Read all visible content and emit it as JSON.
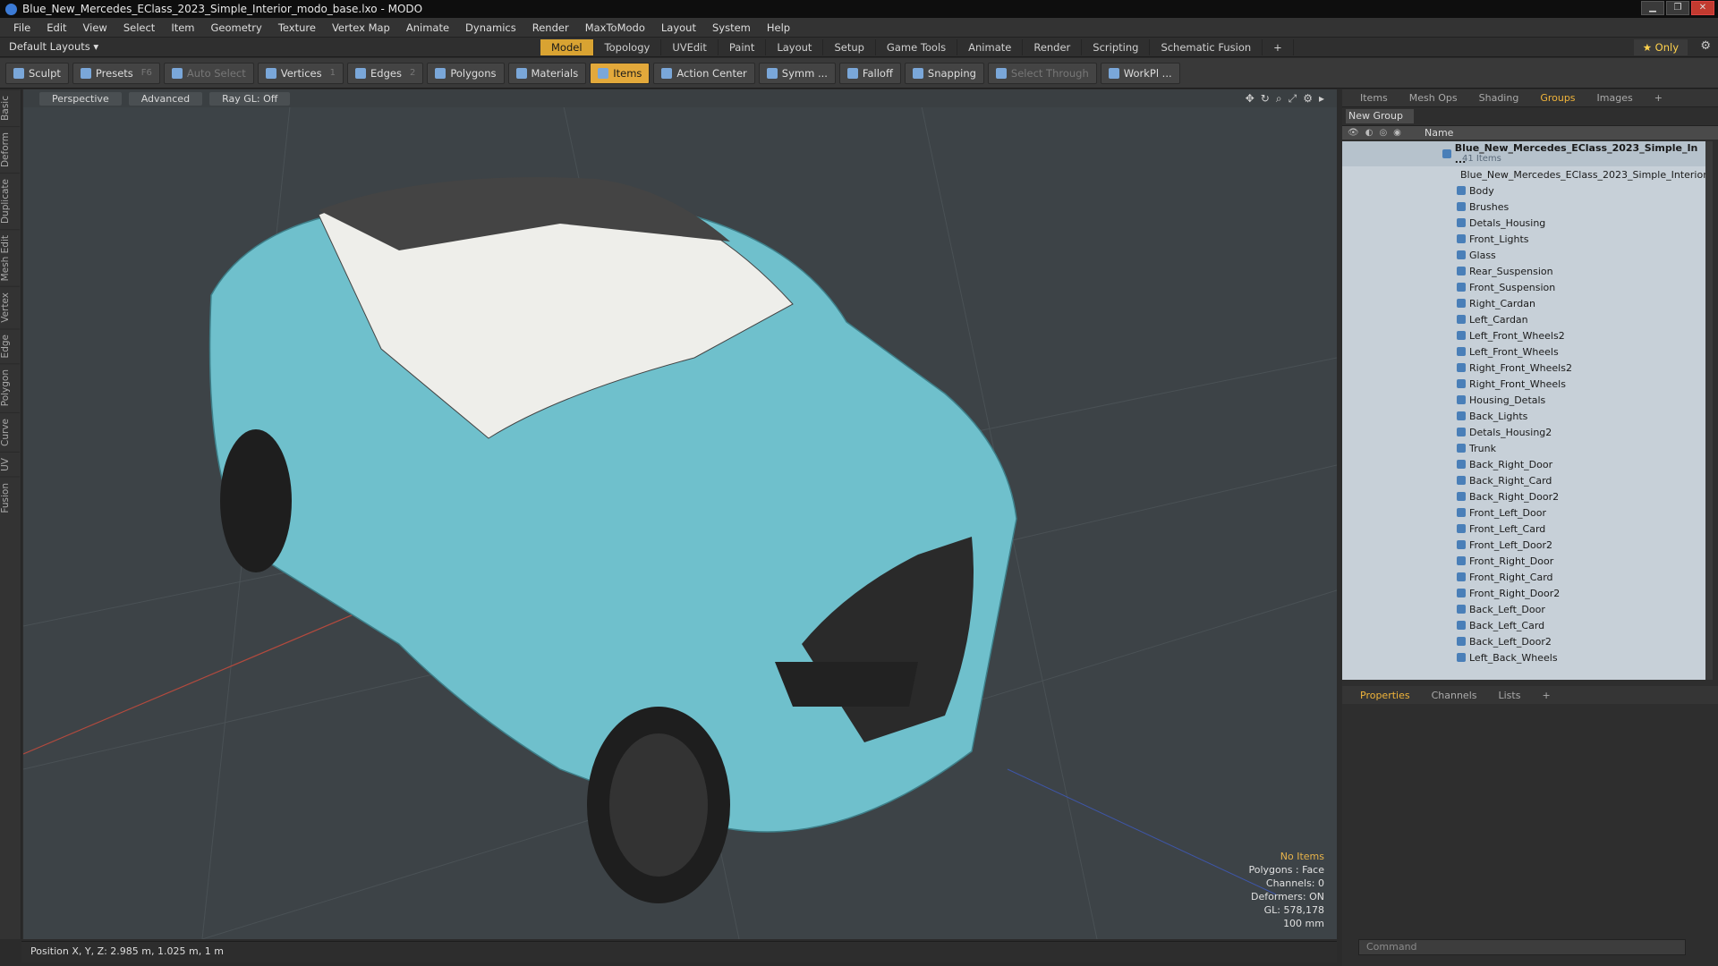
{
  "window": {
    "title": "Blue_New_Mercedes_EClass_2023_Simple_Interior_modo_base.lxo - MODO"
  },
  "menu": [
    "File",
    "Edit",
    "View",
    "Select",
    "Item",
    "Geometry",
    "Texture",
    "Vertex Map",
    "Animate",
    "Dynamics",
    "Render",
    "MaxToModo",
    "Layout",
    "System",
    "Help"
  ],
  "layout": {
    "default_label": "Default Layouts ▾",
    "tabs": [
      "Model",
      "Topology",
      "UVEdit",
      "Paint",
      "Layout",
      "Setup",
      "Game Tools",
      "Animate",
      "Render",
      "Scripting",
      "Schematic Fusion",
      "+"
    ],
    "active_tab": "Model",
    "only_label": "★ Only"
  },
  "toolbar": {
    "sculpt": "Sculpt",
    "presets": "Presets",
    "presets_key": "F6",
    "auto_select": "Auto Select",
    "vertices": "Vertices",
    "vertices_key": "1",
    "edges": "Edges",
    "edges_key": "2",
    "polygons": "Polygons",
    "materials": "Materials",
    "items": "Items",
    "action_center": "Action Center",
    "symm": "Symm ...",
    "falloff": "Falloff",
    "snapping": "Snapping",
    "select_through": "Select Through",
    "workpl": "WorkPl ..."
  },
  "left_tabs": [
    "Basic",
    "Deform",
    "Duplicate",
    "Mesh Edit",
    "Vertex",
    "Edge",
    "Polygon",
    "Curve",
    "UV",
    "Fusion"
  ],
  "viewport": {
    "view": "Perspective",
    "shading": "Advanced",
    "raygl": "Ray GL: Off",
    "stats": {
      "items": "No Items",
      "polygons": "Polygons : Face",
      "channels": "Channels: 0",
      "deformers": "Deformers: ON",
      "gl": "GL: 578,178",
      "scale": "100 mm"
    }
  },
  "status": "Position X, Y, Z:   2.985 m, 1.025 m, 1 m",
  "panel": {
    "tabs": [
      "Items",
      "Mesh Ops",
      "Shading",
      "Groups",
      "Images",
      "+"
    ],
    "active_tab": "Groups",
    "new_group": "New Group",
    "name_header": "Name",
    "root": {
      "name": "Blue_New_Mercedes_EClass_2023_Simple_In ...",
      "count": "41 Items"
    },
    "items": [
      "Blue_New_Mercedes_EClass_2023_Simple_Interior",
      "Body",
      "Brushes",
      "Detals_Housing",
      "Front_Lights",
      "Glass",
      "Rear_Suspension",
      "Front_Suspension",
      "Right_Cardan",
      "Left_Cardan",
      "Left_Front_Wheels2",
      "Left_Front_Wheels",
      "Right_Front_Wheels2",
      "Right_Front_Wheels",
      "Housing_Detals",
      "Back_Lights",
      "Detals_Housing2",
      "Trunk",
      "Back_Right_Door",
      "Back_Right_Card",
      "Back_Right_Door2",
      "Front_Left_Door",
      "Front_Left_Card",
      "Front_Left_Door2",
      "Front_Right_Door",
      "Front_Right_Card",
      "Front_Right_Door2",
      "Back_Left_Door",
      "Back_Left_Card",
      "Back_Left_Door2",
      "Left_Back_Wheels"
    ],
    "bottom_tabs": [
      "Properties",
      "Channels",
      "Lists",
      "+"
    ],
    "bottom_active": "Properties",
    "command_placeholder": "Command"
  },
  "colors": {
    "accent": "#e3a93b",
    "car_body": "#6fc0cc",
    "viewport_bg": "#3d4347"
  }
}
